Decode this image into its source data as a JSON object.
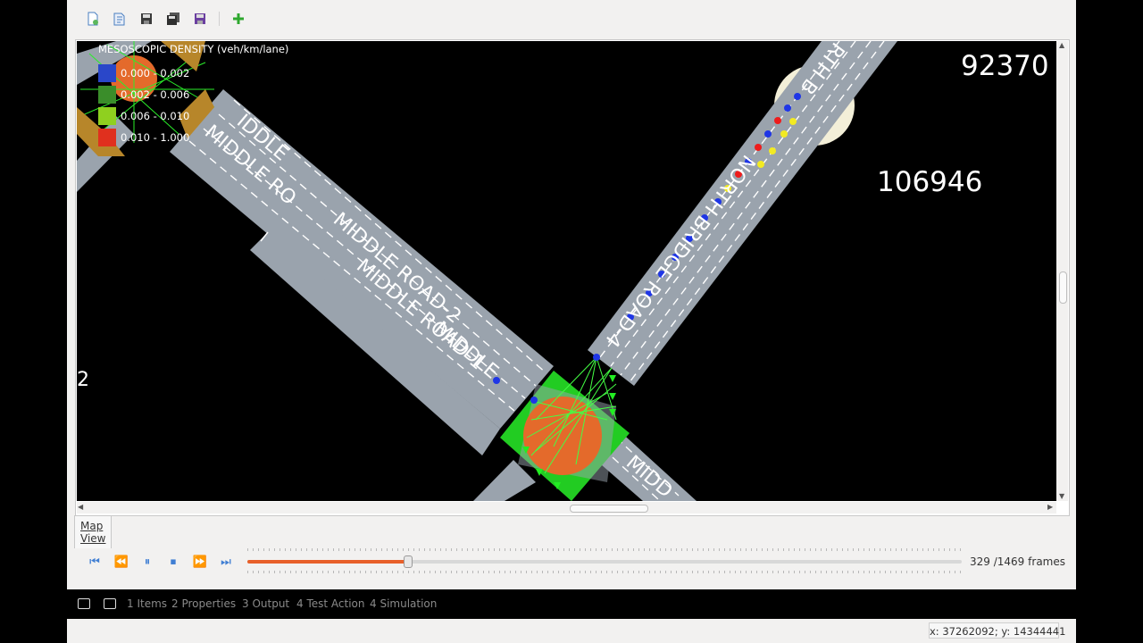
{
  "toolbar": {
    "buttons": [
      {
        "name": "new-file-icon"
      },
      {
        "name": "open-file-icon"
      },
      {
        "name": "save-icon"
      },
      {
        "name": "save-all-icon"
      },
      {
        "name": "save-as-icon"
      },
      {
        "name": "add-icon"
      }
    ]
  },
  "map": {
    "legend": {
      "title": "MESOSCOPIC DENSITY (veh/km/lane)",
      "ranges": [
        {
          "label": "0.000 - 0.002",
          "color": "#2a47c9"
        },
        {
          "label": "0.002 - 0.006",
          "color": "#3a8d2a"
        },
        {
          "label": "0.006 - 0.010",
          "color": "#8fd01f"
        },
        {
          "label": "0.010 - 1.000",
          "color": "#e0301e"
        }
      ]
    },
    "numbers": {
      "top_right": "92370",
      "right": "106946"
    },
    "roads": {
      "middle_2": "MIDDLE ROAD-2",
      "middle_1": "MIDDLE ROAD-1",
      "middle_top": "MIDDLE RO",
      "middle_top2": "MIDDLE",
      "north_bridge": "NORTH BRIDGE ROAD-4",
      "north_bridge_top": "RTH B",
      "bottom": "MIDD",
      "partial_left": "IDDLE",
      "edge_left": "2"
    },
    "colors": {
      "road": "#9aa3ad",
      "junction": "#e46a2b",
      "connector": "#22dd22",
      "vehicle_blue": "#1f36e6",
      "vehicle_red": "#ee1c1c",
      "vehicle_yellow": "#f2ea22"
    }
  },
  "tab": {
    "label": "Map View"
  },
  "playback": {
    "controls": [
      {
        "name": "skip-to-start-icon"
      },
      {
        "name": "rewind-icon"
      },
      {
        "name": "pause-icon"
      },
      {
        "name": "stop-icon"
      },
      {
        "name": "fast-forward-icon"
      },
      {
        "name": "skip-to-end-icon"
      }
    ],
    "current_frame": "329",
    "total_frames": "/1469",
    "unit": "frames",
    "progress": 0.224
  },
  "dock": {
    "tabs": [
      "1 Items",
      "2 Properties",
      "3 Output",
      "4 Test Action",
      "4 Simulation"
    ]
  },
  "status": {
    "coords": "x: 37262092; y: 14344441"
  }
}
